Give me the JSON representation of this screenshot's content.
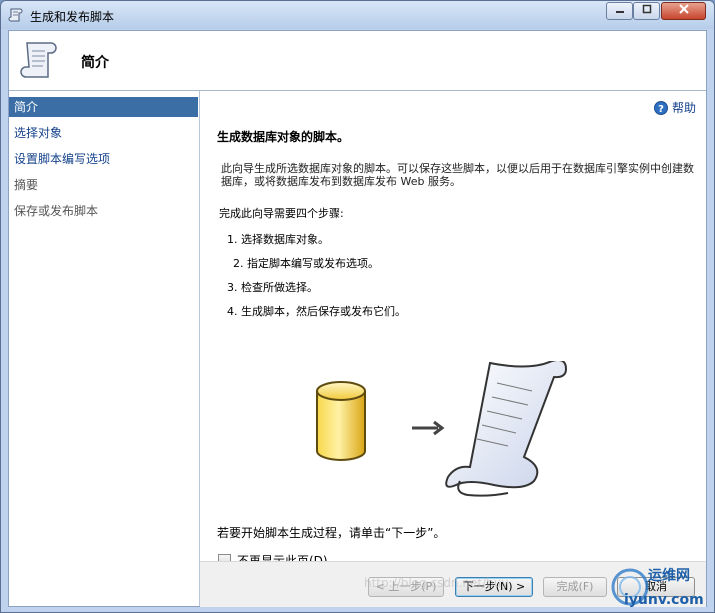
{
  "window": {
    "title": "生成和发布脚本"
  },
  "header": {
    "title": "简介"
  },
  "nav": {
    "items": [
      {
        "label": "简介",
        "state": "active"
      },
      {
        "label": "选择对象",
        "state": "link"
      },
      {
        "label": "设置脚本编写选项",
        "state": "link"
      },
      {
        "label": "摘要",
        "state": "disabled"
      },
      {
        "label": "保存或发布脚本",
        "state": "disabled"
      }
    ]
  },
  "content": {
    "help_label": "帮助",
    "heading": "生成数据库对象的脚本。",
    "paragraph": "此向导生成所选数据库对象的脚本。可以保存这些脚本，以便以后用于在数据库引擎实例中创建数据库，或将数据库发布到数据库发布 Web 服务。",
    "steps_intro": "完成此向导需要四个步骤:",
    "steps": [
      "1.  选择数据库对象。",
      "2.  指定脚本编写或发布选项。",
      "3.  检查所做选择。",
      "4.  生成脚本，然后保存或发布它们。"
    ],
    "start_hint": "若要开始脚本生成过程，请单击“下一步”。",
    "dont_show_label": "不再显示此页(D)。"
  },
  "footer": {
    "prev_label": "< 上一步(P)",
    "next_label": "下一步(N) >",
    "finish_label": "完成(F)",
    "cancel_label": "取消"
  },
  "watermark": {
    "brand": "运维网",
    "domain": "iyunv.com",
    "url_text": "http://blog.csdn.net/huy"
  },
  "colors": {
    "nav_active": "#3a6ea5",
    "link": "#15428b",
    "window_frame": "#bfd3ee"
  }
}
